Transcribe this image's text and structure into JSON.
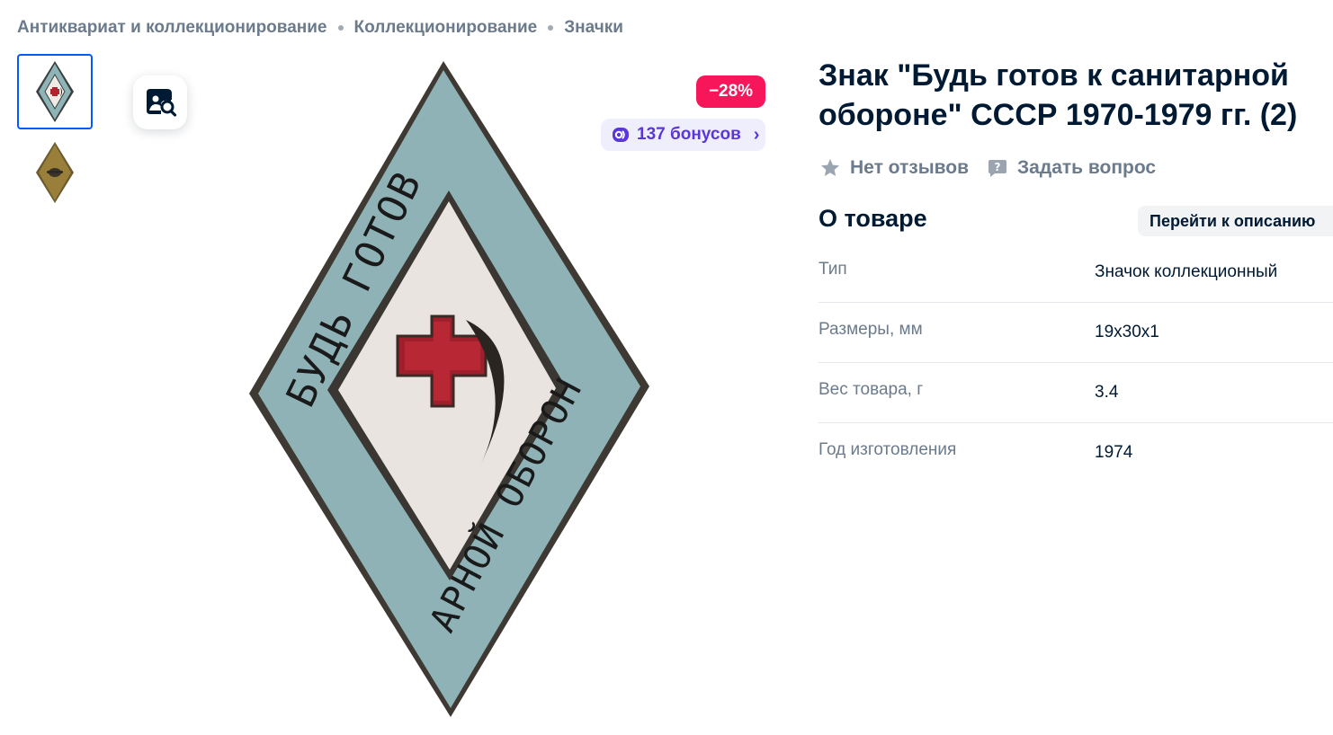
{
  "breadcrumbs": [
    "Антиквариат и коллекционирование",
    "Коллекционирование",
    "Значки"
  ],
  "badges": {
    "discount": "−28%",
    "bonus": "137 бонусов"
  },
  "product": {
    "title": "Знак \"Будь готов к санитарной обороне\" СССР 1970-1979 гг. (2)"
  },
  "reviews": {
    "no_reviews": "Нет отзывов",
    "ask_question": "Задать вопрос"
  },
  "about": {
    "title": "О товаре",
    "goto_description": "Перейти к описанию",
    "specs": [
      {
        "key": "Тип",
        "value": "Значок коллекционный"
      },
      {
        "key": "Размеры, мм",
        "value": "19x30x1"
      },
      {
        "key": "Вес товара, г",
        "value": "3.4"
      },
      {
        "key": "Год изготовления",
        "value": "1974"
      }
    ]
  },
  "badge_image": {
    "text_left": "БУДЬ ГОТОВ К САНИТ",
    "text_right": "АРНОЙ ОБОРОНЕ СССР"
  },
  "colors": {
    "accent": "#005bff",
    "discount": "#f8165a",
    "bonus_text": "#5b37d8",
    "bonus_bg": "#efeefc",
    "text_primary": "#001a34",
    "text_secondary": "#6b7b8c"
  },
  "icons": {
    "visual_search": "camera-search-icon",
    "star": "star-icon",
    "question": "question-bubble-icon",
    "bonus": "bonus-coin-icon",
    "chevron": "chevron-right-icon"
  }
}
